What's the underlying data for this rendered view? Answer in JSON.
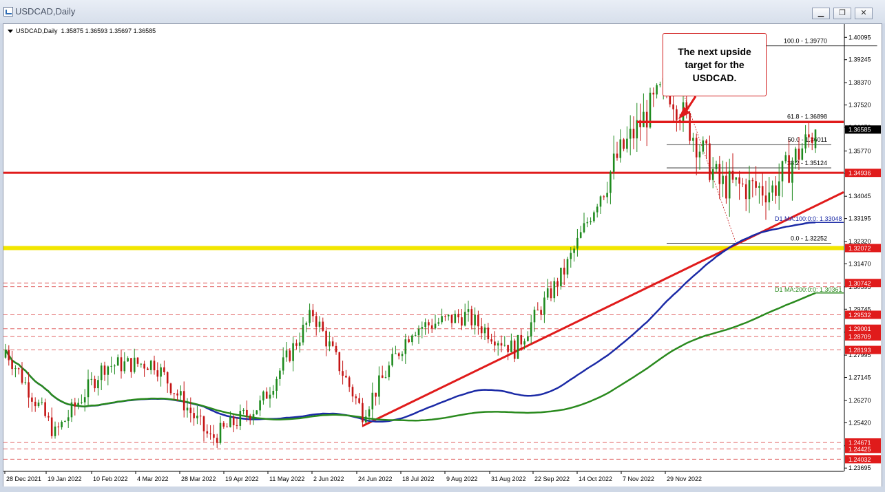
{
  "window": {
    "title": "USDCAD,Daily",
    "minimize_glyph": "▁",
    "restore_glyph": "❐",
    "close_glyph": "✕"
  },
  "header": {
    "symbol": "USDCAD,Daily",
    "ohlc": "1.35875 1.36593 1.35697 1.36585"
  },
  "callout": {
    "text": "The next upside target for the USDCAD."
  },
  "colors": {
    "bull_candle": "#1e8a1e",
    "bear_candle": "#c41414",
    "ma100": "#1b2aa6",
    "ma200": "#2a8a1e",
    "support_red": "#e01b1b",
    "support_yellow": "#f2e600",
    "dashed_red": "#e06060"
  },
  "chart_data": {
    "type": "candlestick",
    "symbol": "USDCAD",
    "timeframe": "Daily",
    "ylim": [
      1.2357,
      1.406
    ],
    "y_ticks": [
      1.40095,
      1.39245,
      1.3837,
      1.3752,
      1.3667,
      1.3577,
      1.3492,
      1.34045,
      1.33195,
      1.3232,
      1.3147,
      1.30595,
      1.29745,
      1.2887,
      1.27995,
      1.27145,
      1.2627,
      1.2542,
      1.24545,
      1.23695
    ],
    "x_ticks": [
      "28 Dec 2021",
      "19 Jan 2022",
      "10 Feb 2022",
      "4 Mar 2022",
      "28 Mar 2022",
      "19 Apr 2022",
      "11 May 2022",
      "2 Jun 2022",
      "24 Jun 2022",
      "18 Jul 2022",
      "9 Aug 2022",
      "31 Aug 2022",
      "22 Sep 2022",
      "14 Oct 2022",
      "7 Nov 2022",
      "29 Nov 2022"
    ],
    "series": [
      {
        "date": "28 Dec 2021",
        "close": 1.282
      },
      {
        "date": "19 Jan 2022",
        "close": 1.25
      },
      {
        "date": "10 Feb 2022",
        "close": 1.276
      },
      {
        "date": "4 Mar 2022",
        "close": 1.277
      },
      {
        "date": "28 Mar 2022",
        "close": 1.248
      },
      {
        "date": "19 Apr 2022",
        "close": 1.261
      },
      {
        "date": "11 May 2022",
        "close": 1.296
      },
      {
        "date": "2 Jun 2022",
        "close": 1.258
      },
      {
        "date": "24 Jun 2022",
        "close": 1.29
      },
      {
        "date": "18 Jul 2022",
        "close": 1.295
      },
      {
        "date": "9 Aug 2022",
        "close": 1.282
      },
      {
        "date": "31 Aug 2022",
        "close": 1.312
      },
      {
        "date": "22 Sep 2022",
        "close": 1.355
      },
      {
        "date": "14 Oct 2022",
        "close": 1.383
      },
      {
        "date": "7 Nov 2022",
        "close": 1.345
      },
      {
        "date": "29 Nov 2022",
        "close": 1.343
      },
      {
        "date": "5 Dec 2022",
        "close": 1.36585
      }
    ],
    "price_labels": [
      {
        "value": 1.36585,
        "text": "1.36585",
        "style": "current"
      },
      {
        "value": 1.34936,
        "text": "1.34936",
        "style": "red"
      },
      {
        "value": 1.32072,
        "text": "1.32072",
        "style": "red"
      },
      {
        "value": 1.30742,
        "text": "1.30742",
        "style": "red"
      },
      {
        "value": 1.29532,
        "text": "1.29532",
        "style": "red"
      },
      {
        "value": 1.29001,
        "text": "1.29001",
        "style": "red"
      },
      {
        "value": 1.28709,
        "text": "1.28709",
        "style": "red"
      },
      {
        "value": 1.28193,
        "text": "1.28193",
        "style": "red"
      },
      {
        "value": 1.24671,
        "text": "1.24671",
        "style": "red"
      },
      {
        "value": 1.24425,
        "text": "1.24425",
        "style": "red"
      },
      {
        "value": 1.24032,
        "text": "1.24032",
        "style": "red"
      }
    ],
    "fib_levels": [
      {
        "label": "100.0 - 1.39770",
        "value": 1.3977
      },
      {
        "label": "61.8 - 1.36898",
        "value": 1.36898
      },
      {
        "label": "50.0 - 1.36011",
        "value": 1.36011
      },
      {
        "label": "38.2 - 1.35124",
        "value": 1.35124
      },
      {
        "label": "0.0 - 1.32252",
        "value": 1.32252
      }
    ],
    "ma_labels": [
      {
        "text": "D1 MA:100:0:0: 1.33048",
        "value": 1.33048
      },
      {
        "text": "D1 MA:200:0:0: 1.30361",
        "value": 1.30361
      }
    ],
    "horizontal_levels": {
      "solid_red": [
        1.34936
      ],
      "yellow": [
        1.32072
      ],
      "dashed_red": [
        1.30742,
        1.306,
        1.29532,
        1.29001,
        1.28709,
        1.28193,
        1.24671,
        1.24425,
        1.24032
      ],
      "target_red": [
        1.36898
      ]
    },
    "trendline": {
      "from": {
        "date": "2 Jun 2022",
        "value": 1.253
      },
      "to": {
        "date": "right-edge",
        "value": 1.342
      }
    },
    "legend": "none",
    "grid": false
  }
}
